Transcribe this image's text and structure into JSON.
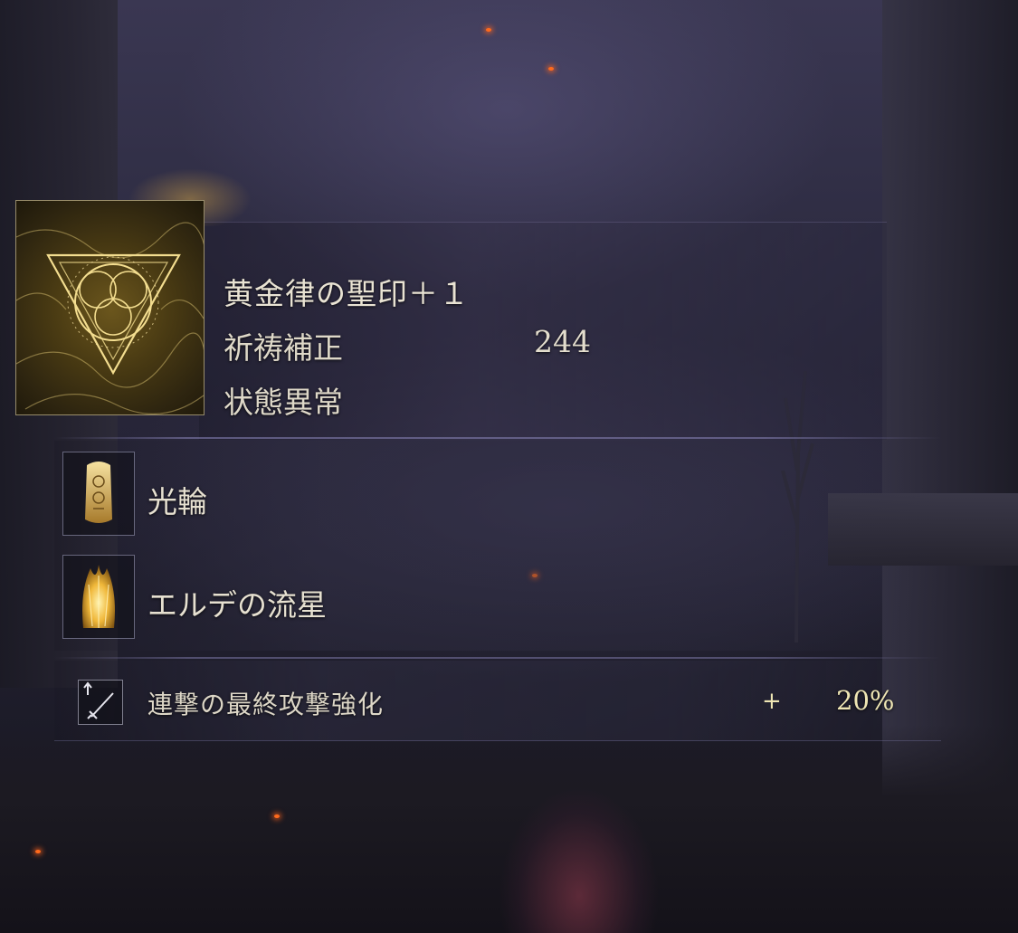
{
  "item": {
    "name": "黄金律の聖印＋１",
    "icon": "golden-order-seal-icon"
  },
  "stats": {
    "incant_scaling_label": "祈祷補正",
    "incant_scaling_value": "244",
    "status_label": "状態異常"
  },
  "incantations": [
    {
      "name": "光輪",
      "icon": "halo-incantation-icon"
    },
    {
      "name": "エルデの流星",
      "icon": "elden-stars-incantation-icon"
    }
  ],
  "passive": {
    "name": "連撃の最終攻撃強化",
    "sign": "+",
    "value": "20%",
    "icon": "sword-boost-icon"
  },
  "colors": {
    "gold_text": "#efe6b4",
    "item_gold": "#6b561d"
  }
}
